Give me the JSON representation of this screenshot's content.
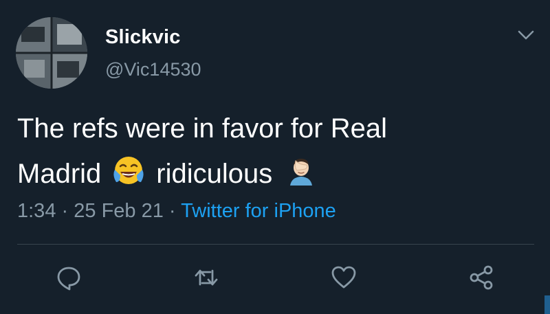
{
  "tweet": {
    "author_name": "Slickvic",
    "author_handle": "@Vic14530",
    "text_line1": "The refs were in favor for Real",
    "text_line2_a": "Madrid",
    "text_line2_b": "ridiculous",
    "emojis": [
      "face-with-tears-of-joy",
      "person-facepalming"
    ],
    "time": "1:34",
    "date": "25 Feb 21",
    "separator": "·",
    "source": "Twitter for iPhone"
  },
  "icons": {
    "more": "chevron-down-icon",
    "reply": "reply-icon",
    "retweet": "retweet-icon",
    "like": "heart-icon",
    "share": "share-icon"
  },
  "colors": {
    "background": "#15202b",
    "primary_text": "#ffffff",
    "secondary_text": "#8899a6",
    "link": "#1da1f2",
    "divider": "#38444d"
  }
}
